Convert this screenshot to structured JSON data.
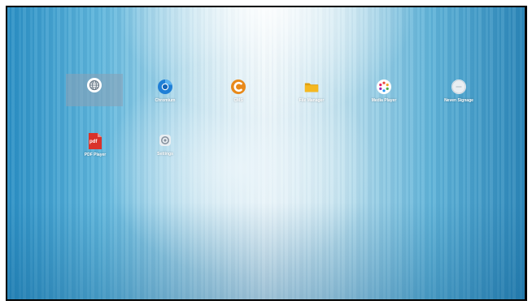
{
  "apps": [
    {
      "label": "",
      "icon": "browser-globe-icon",
      "selected": true
    },
    {
      "label": "Chromium",
      "icon": "chromium-icon"
    },
    {
      "label": "CMS",
      "icon": "cms-icon"
    },
    {
      "label": "File Manager",
      "icon": "folder-icon"
    },
    {
      "label": "Media Player",
      "icon": "media-player-icon"
    },
    {
      "label": "Neven Signage",
      "icon": "signage-icon"
    },
    {
      "label": "PDF Player",
      "icon": "pdf-icon",
      "badge": "pdf"
    },
    {
      "label": "Settings",
      "icon": "settings-gear-icon"
    }
  ],
  "colors": {
    "accent": "#e8891a",
    "pdf_red": "#d9322b",
    "chromium_blue": "#1f7fd6",
    "folder_yellow": "#f5b820"
  }
}
